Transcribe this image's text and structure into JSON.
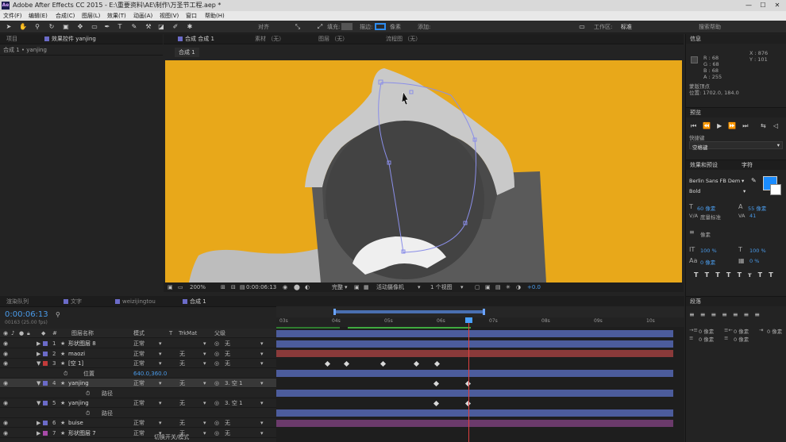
{
  "app": {
    "title": "Adobe After Effects CC 2015 - E:\\重要资料\\AE\\制作\\万圣节工程.aep *",
    "icon": "Ae"
  },
  "menu": [
    "文件(F)",
    "编辑(E)",
    "合成(C)",
    "图层(L)",
    "效果(T)",
    "动画(A)",
    "视图(V)",
    "窗口",
    "帮助(H)"
  ],
  "toolbar": {
    "align_label": "对齐",
    "fill_label": "填充:",
    "stroke_label": "描边:",
    "px_label": "像素",
    "add_label": "添加:",
    "workspace_label": "工作区:",
    "workspace_value": "标准",
    "search_help": "搜索帮助"
  },
  "left_panel": {
    "tab_project": "项目",
    "tab_effects": "效果控件 yanjing",
    "breadcrumb": "合成 1 • yanjing"
  },
  "viewer": {
    "tab_comp": "合成 合成 1",
    "tab_footage": "素材 （无）",
    "tab_layer": "图层 （无）",
    "tab_flow": "流程图 （无）",
    "sub_tab": "合成 1",
    "zoom": "200%",
    "timecode": "0:00:06:13",
    "quality": "完整",
    "camera": "活动摄像机",
    "views": "1 个视图",
    "exposure": "+0.0"
  },
  "info_panel": {
    "title": "信息",
    "r": "R : 68",
    "g": "G : 68",
    "b": "B : 68",
    "a": "A : 255",
    "x": "X : 876",
    "y": "Y : 101",
    "vertex_label": "蒙版顶点",
    "vertex_pos": "位置: 1702.0, 184.0"
  },
  "preview_panel": {
    "title": "预览",
    "shortcut_label": "快捷键",
    "shortcut_value": "空格键"
  },
  "char_panel": {
    "tab_effects": "效果和预设",
    "tab_char": "字符",
    "font": "Berlin Sans FB Dem",
    "style": "Bold",
    "size": "60 像素",
    "leading": "55 像素",
    "tracking_label": "度量标准",
    "tracking": "41",
    "stroke_px": "像素",
    "vscale": "100 %",
    "hscale": "100 %",
    "baseline": "0 像素",
    "tsume": "0 %",
    "accent_color": "#1a8cff"
  },
  "para_panel": {
    "title": "段落",
    "indent1": "0 像素",
    "indent2": "0 像素",
    "indent3": "0 像素",
    "space1": "0 像素",
    "space2": "0 像素"
  },
  "timeline": {
    "tab_render": "渲染队列",
    "tab_text": "文字",
    "tab_wz": "weizijingtou",
    "tab_comp": "合成 1",
    "timecode": "0:00:06:13",
    "frames": "00163 (25.00 fps)",
    "col_name": "图层名称",
    "col_mode": "模式",
    "col_t": "T",
    "col_trkmat": "TrkMat",
    "col_parent": "父级",
    "footer": "切换开关/模式",
    "ruler": [
      "03s",
      "04s",
      "05s",
      "06s",
      "07s",
      "08s",
      "09s",
      "10s"
    ],
    "layers": [
      {
        "num": "1",
        "name": "形状图层 8",
        "mode": "正常",
        "trk": "",
        "parent": "无",
        "color": "#6b6bc8"
      },
      {
        "num": "2",
        "name": "maozi",
        "mode": "正常",
        "trk": "无",
        "parent": "无",
        "color": "#6b6bc8"
      },
      {
        "num": "3",
        "name": "[空 1]",
        "mode": "正常",
        "trk": "无",
        "parent": "无",
        "color": "#c23b3b"
      },
      {
        "num": "4",
        "name": "yanjing",
        "mode": "正常",
        "trk": "无",
        "parent": "3. 空 1",
        "color": "#6b6bc8"
      },
      {
        "num": "5",
        "name": "yanjing",
        "mode": "正常",
        "trk": "无",
        "parent": "3. 空 1",
        "color": "#6b6bc8"
      },
      {
        "num": "6",
        "name": "buise",
        "mode": "正常",
        "trk": "无",
        "parent": "无",
        "color": "#6b6bc8"
      },
      {
        "num": "7",
        "name": "形状图层 7",
        "mode": "正常",
        "trk": "无",
        "parent": "无",
        "color": "#a84aa8"
      }
    ],
    "prop_position": "位置",
    "prop_position_value": "640.0,360.0",
    "prop_path": "路径"
  }
}
